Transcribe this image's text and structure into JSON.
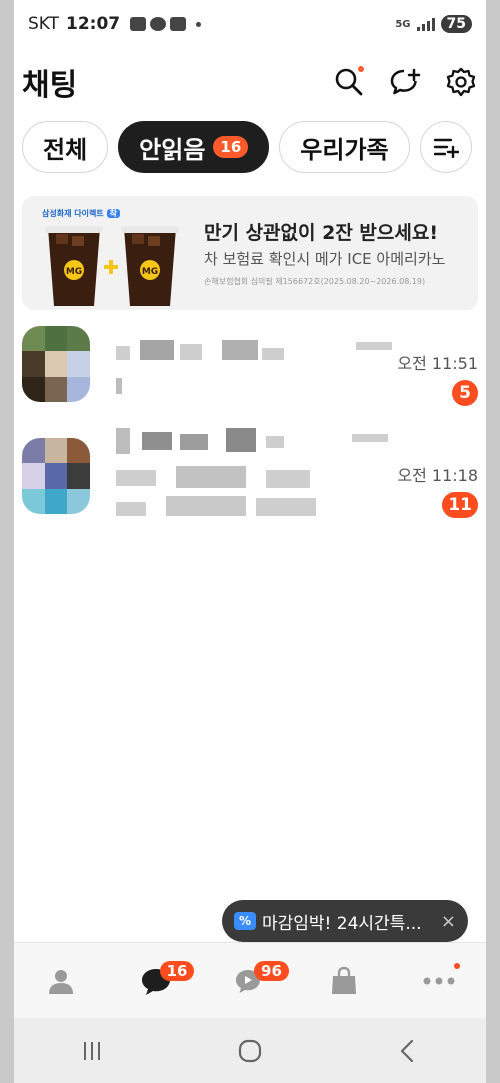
{
  "status": {
    "carrier": "SKT",
    "time": "12:07",
    "network": "5G",
    "battery": "75"
  },
  "header": {
    "title": "채팅"
  },
  "tabs": [
    {
      "label": "전체",
      "active": false
    },
    {
      "label": "안읽음",
      "count": "16",
      "active": true
    },
    {
      "label": "우리가족",
      "active": false
    }
  ],
  "ad": {
    "brand": "삼성화재 다이렉트",
    "brand_badge": "착",
    "title": "만기 상관없이 2잔 받으세요!",
    "subtitle": "차 보험료 확인시 메가 ICE 아메리카노",
    "fineprint": "손해보험협회 심의필 제156672호(2025.08.20~2026.08.19)"
  },
  "chats": [
    {
      "time": "오전 11:51",
      "unread": "5"
    },
    {
      "time": "오전 11:18",
      "unread": "11"
    }
  ],
  "toast": {
    "icon": "%",
    "text": "마감임박! 24시간특...",
    "close": "×"
  },
  "bottom_nav": {
    "chats_badge": "16",
    "openchat_badge": "96"
  },
  "colors": {
    "accent": "#ff4d1f",
    "active_tab": "#1e1e1e"
  }
}
